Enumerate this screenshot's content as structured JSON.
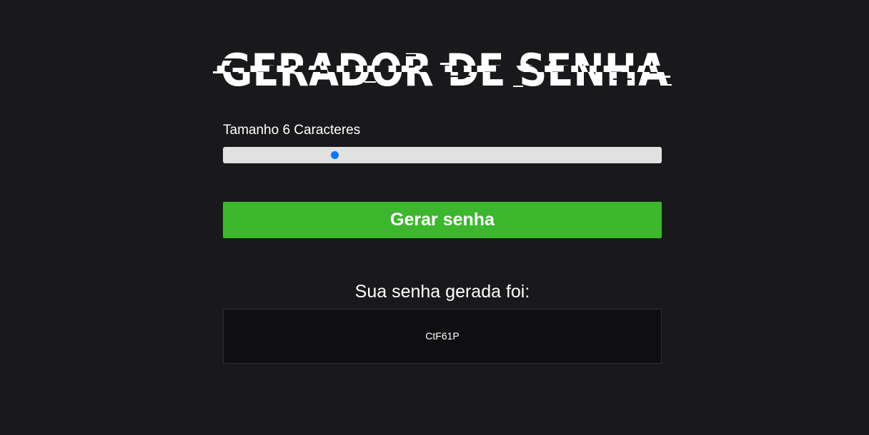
{
  "header": {
    "title": "GERADOR DE SENHA"
  },
  "length_control": {
    "label": "Tamanho 6 Caracteres",
    "value": 6,
    "value_fraction": 0.25
  },
  "actions": {
    "generate_label": "Gerar senha"
  },
  "result": {
    "heading": "Sua senha gerada foi:",
    "password": "CtF61P"
  },
  "colors": {
    "background": "#19191b",
    "button": "#3db72e",
    "slider_thumb": "#0b78f0"
  }
}
